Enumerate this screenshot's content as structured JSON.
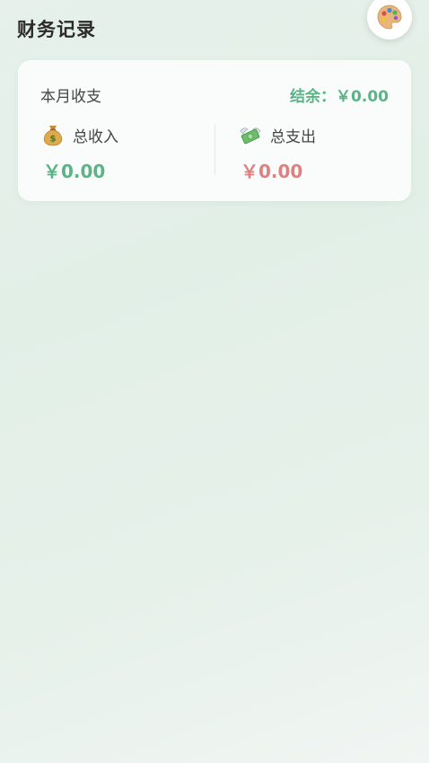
{
  "header": {
    "title": "财务记录",
    "theme_icon": "palette-icon"
  },
  "summary": {
    "title": "本月收支",
    "balance_label": "结余：",
    "balance_value": "￥0.00",
    "income": {
      "icon": "money-bag-icon",
      "label": "总收入",
      "value": "￥0.00"
    },
    "expense": {
      "icon": "money-with-wings-icon",
      "label": "总支出",
      "value": "￥0.00"
    }
  },
  "colors": {
    "income": "#5cb387",
    "expense": "#e07f7f",
    "balance": "#5cb387"
  }
}
